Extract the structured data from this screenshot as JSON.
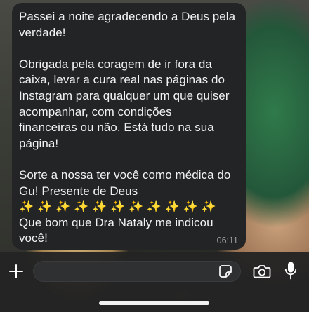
{
  "message": {
    "text": "Passei a noite agradecendo a Deus pela\nverdade!\n\nObrigada pela coragem de ir fora da\ncaixa, levar a cura real nas páginas do\nInstagram para qualquer um que quiser\nacompanhar, com condições\nfinanceiras ou não. Está tudo na sua\npágina!\n\nSorte a nossa ter você como médica do\nGu! Presente de Deus\n✨ ✨ ✨ ✨ ✨ ✨ ✨ ✨ ✨ ✨ ✨\nQue bom que Dra Nataly me indicou\nvocê!",
    "time": "06:11"
  },
  "composer": {
    "input_value": "",
    "icons": {
      "add": "plus-icon",
      "sticker": "sticker-icon",
      "camera": "camera-icon",
      "mic": "microphone-icon"
    }
  },
  "colors": {
    "bubble": "#222426",
    "composer": "#242424",
    "icon": "#ffffff"
  }
}
